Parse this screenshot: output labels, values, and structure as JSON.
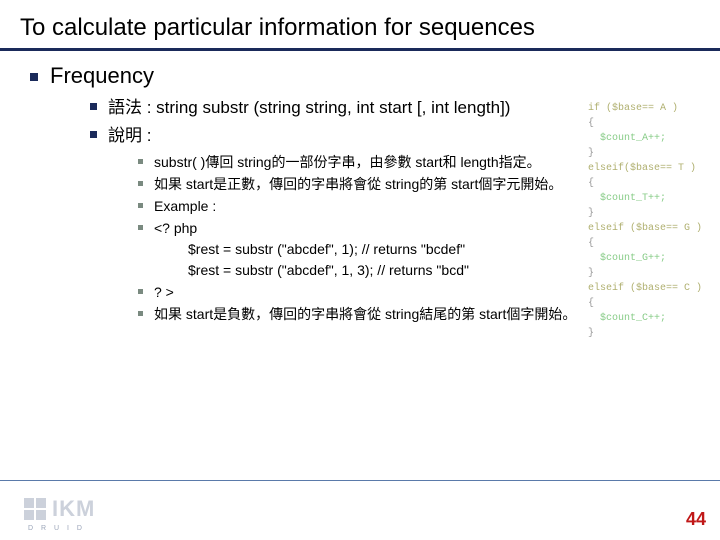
{
  "title": "To calculate particular information for sequences",
  "section": "Frequency",
  "sub": {
    "syntax_label": "語法 : string substr (string string, int start [, int length])",
    "desc_label": "說明 :"
  },
  "details": {
    "d1": "substr( )傳回 string的一部份字串，由參數 start和 length指定。",
    "d2": "如果 start是正數，傳回的字串將會從 string的第 start個字元開始。",
    "d3": "Example :",
    "d4": "<? php",
    "d4a": "$rest = substr (\"abcdef\", 1);       // returns \"bcdef\"",
    "d4b": "$rest = substr (\"abcdef\", 1, 3);   // returns \"bcd\"",
    "d5": "? >",
    "d6": "如果 start是負數，傳回的字串將會從 string結尾的第 start個字開始。"
  },
  "code": {
    "l1": "if ($base== A )",
    "l2": "{",
    "l3": "  $count_A++;",
    "l4": "}",
    "l5": "elseif($base== T )",
    "l6": "{",
    "l7": "  $count_T++;",
    "l8": "}",
    "l9": "elseif ($base== G )",
    "l10": "{",
    "l11": "  $count_G++;",
    "l12": "}",
    "l13": "elseif ($base== C )",
    "l14": "{",
    "l15": "  $count_C++;",
    "l16": "}"
  },
  "logo_text": "IKM",
  "logo_sub": "D R U I D",
  "page_num": "44"
}
